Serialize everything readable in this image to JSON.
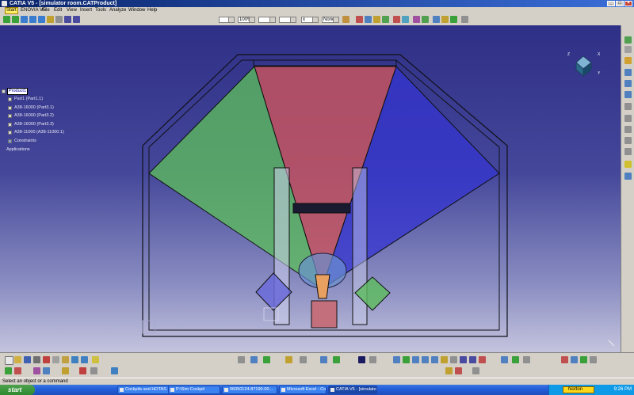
{
  "window": {
    "title": "CATIA V5 - [simulator room.CATProduct]",
    "buttons": [
      "_",
      "□",
      "×"
    ]
  },
  "menu": {
    "items": [
      "Start",
      "ENOVIA V5",
      "File",
      "Edit",
      "View",
      "Insert",
      "Tools",
      "Analyze",
      "Window",
      "Help"
    ]
  },
  "toolbar": {
    "zoom_value": "100%",
    "layer_value": "None",
    "cross_value": "x"
  },
  "tree": {
    "root": "Product1",
    "items": [
      "Part1 (Part1.1)",
      "A38-16000 (Part3.1)",
      "A38-16000 (Part3.2)",
      "A38-16000 (Part3.3)",
      "A38-11000 (A38-11000.1)",
      "Constraints",
      "Applications"
    ]
  },
  "compass": {
    "x_label": "X",
    "y_label": "Y",
    "z_label": "Z"
  },
  "status": {
    "text": "Select an object or a command"
  },
  "taskbar": {
    "start_label": "start",
    "buttons": [
      "Cockpits and HOTAS ...",
      "P:\\Sim Cockpit",
      "06050124-87190-00...",
      "Microsoft Excel - Coc...",
      "CATIA V5 - [simulator..."
    ],
    "norton": "Norton",
    "clock": "9:26 PM"
  },
  "colors": {
    "viewport_top": "#2e2f86",
    "viewport_bottom": "#c4c4de",
    "frustum_green": "#5cbd5c",
    "frustum_red": "#c8545e",
    "frustum_blue": "#3434d0"
  }
}
